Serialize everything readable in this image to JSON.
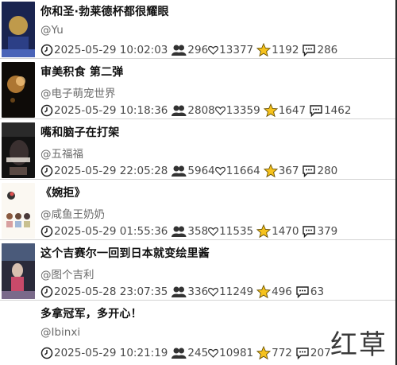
{
  "items": [
    {
      "title": "你和圣·勃莱德杯都很耀眼",
      "author": "@Yu",
      "time": "2025-05-29 10:02:03",
      "plays": "296",
      "likes": "13377",
      "stars": "1192",
      "comments": "286"
    },
    {
      "title": "审美积食 第二弹",
      "author": "@电子萌宠世界",
      "time": "2025-05-29 10:18:36",
      "plays": "2808",
      "likes": "13359",
      "stars": "1647",
      "comments": "1462"
    },
    {
      "title": "嘴和脑子在打架",
      "author": "@五福福",
      "time": "2025-05-29 22:05:28",
      "plays": "5964",
      "likes": "11664",
      "stars": "367",
      "comments": "280"
    },
    {
      "title": "《婉拒》",
      "author": "@咸鱼王奶奶",
      "time": "2025-05-29 01:55:36",
      "plays": "358",
      "likes": "11535",
      "stars": "1470",
      "comments": "379"
    },
    {
      "title": "这个吉赛尔一回到日本就变绘里酱",
      "author": "@图个吉利",
      "time": "2025-05-28 23:07:35",
      "plays": "336",
      "likes": "11249",
      "stars": "496",
      "comments": "63"
    },
    {
      "title": "多拿冠军，多开心！",
      "author": "@Ibinxi",
      "time": "2025-05-29 10:21:19",
      "plays": "245",
      "likes": "10981",
      "stars": "772",
      "comments": "207"
    }
  ],
  "watermark": "红草",
  "colors": {
    "star": "#f6c21c",
    "star_outline": "#6a5200",
    "text": "#111111",
    "muted": "#6b6b6b"
  }
}
